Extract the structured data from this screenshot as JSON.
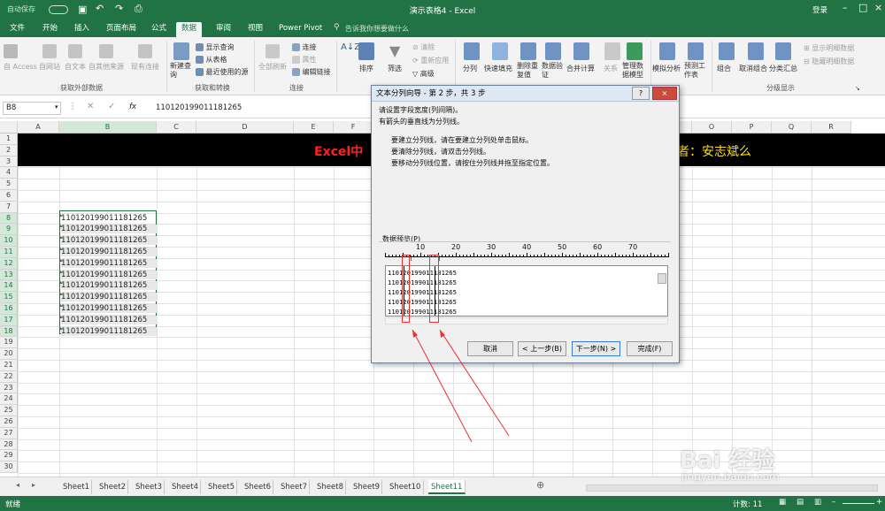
{
  "titlebar": {
    "quick_access_toggle": "自动保存",
    "file_name": "演示表格4",
    "app": "Excel",
    "dash": "-",
    "login": "登录"
  },
  "tabs": [
    "文件",
    "开始",
    "插入",
    "页面布局",
    "公式",
    "数据",
    "审阅",
    "视图",
    "Power Pivot"
  ],
  "tell_me": "告诉我你想要做什么",
  "ribbon": {
    "get_external": {
      "items": [
        "自 Access",
        "自网站",
        "自文本",
        "自其他来源",
        "现有连接"
      ],
      "group": "获取外部数据"
    },
    "transform": {
      "new_query": "新建查询",
      "show_queries": "显示查询",
      "from_table": "从表格",
      "recent_sources": "最近使用的源",
      "group": "获取和转换"
    },
    "connections": {
      "refresh_all": "全部刷新",
      "connections": "连接",
      "properties": "属性",
      "edit_links": "编辑链接",
      "group": "连接"
    },
    "sort": {
      "sort": "排序",
      "filter": "筛选",
      "clear": "清除",
      "reapply": "重新应用",
      "advanced": "高级"
    },
    "tools": {
      "split": "分列",
      "flash_fill": "快速填充",
      "remove_dup": "删除重复值",
      "validation": "数据验证",
      "consolidate": "合并计算",
      "relations": "关系",
      "manage_model": "管理数据模型"
    },
    "forecast": {
      "what_if": "模拟分析",
      "forecast_sheet": "预测工作表"
    },
    "outline": {
      "group_btn": "组合",
      "ungroup": "取消组合",
      "subtotal": "分类汇总",
      "show_detail": "显示明细数据",
      "hide_detail": "隐藏明细数据",
      "group": "分级显示"
    }
  },
  "formula_bar": {
    "name_box": "B8",
    "value": "110120199011181265",
    "fx": "fx"
  },
  "columns": [
    "A",
    "B",
    "C",
    "D",
    "E",
    "F",
    "G",
    "H",
    "I",
    "J",
    "K",
    "L",
    "M",
    "N",
    "O",
    "P",
    "Q",
    "R"
  ],
  "rows": [
    "1",
    "2",
    "3",
    "4",
    "5",
    "6",
    "7",
    "8",
    "9",
    "10",
    "11",
    "12",
    "13",
    "14",
    "15",
    "16",
    "17",
    "18",
    "19",
    "20",
    "21",
    "22",
    "23",
    "24",
    "25",
    "26",
    "27",
    "28",
    "29",
    "30"
  ],
  "banner": {
    "left": "Excel中",
    "right": "者：安志斌么"
  },
  "cells": [
    "110120199011181265",
    "110120199011181265",
    "110120199011181265",
    "110120199011181265",
    "110120199011181265",
    "110120199011181265",
    "110120199011181265",
    "110120199011181265",
    "110120199011181265",
    "110120199011181265",
    "110120199011181265"
  ],
  "sheets": [
    "Sheet1",
    "Sheet2",
    "Sheet3",
    "Sheet4",
    "Sheet5",
    "Sheet6",
    "Sheet7",
    "Sheet8",
    "Sheet9",
    "Sheet10",
    "Sheet11"
  ],
  "status": {
    "ready": "就绪",
    "count": "计数: 11"
  },
  "dialog": {
    "title": "文本分列向导 - 第 2 步，共 3 步",
    "instructions": [
      "请设置字段宽度(列间隔)。",
      "有箭头的垂直线为分列线。"
    ],
    "tips": [
      "要建立分列线，请在要建立分列处单击鼠标。",
      "要清除分列线，请双击分列线。",
      "要移动分列线位置，请按住分列线并拖至指定位置。"
    ],
    "preview_label": "数据预览(P)",
    "ruler": [
      "10",
      "20",
      "30",
      "40",
      "50",
      "60",
      "70"
    ],
    "preview_lines": [
      "110120199011181265",
      "110120199011181265",
      "110120199011181265",
      "110120199011181265",
      "110120199011181265"
    ],
    "buttons": {
      "cancel": "取消",
      "back": "< 上一步(B)",
      "next": "下一步(N) >",
      "finish": "完成(F)"
    },
    "help": "?",
    "close": "×"
  },
  "watermark": {
    "logo": "Bai 经验",
    "url": "jingyan.baidu.com"
  },
  "colors": {
    "excel_green": "#217346",
    "banner_bg": "#000000",
    "banner_red": "#ff2020",
    "banner_yellow": "#ffe000",
    "annot_red": "#e8332f"
  }
}
